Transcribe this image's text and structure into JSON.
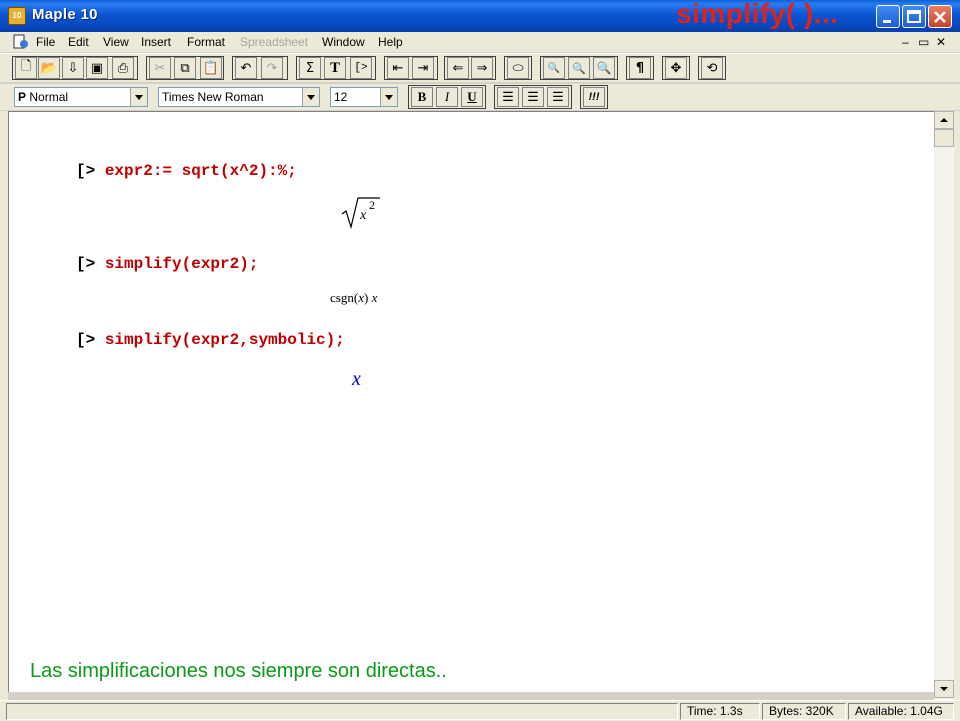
{
  "window": {
    "title": "Maple 10",
    "overlay_title": "simplify( )...",
    "app_icon_text": "10",
    "controls": [
      "minimize",
      "maximize",
      "close"
    ]
  },
  "menubar": {
    "items": [
      {
        "label": "File",
        "enabled": true
      },
      {
        "label": "Edit",
        "enabled": true
      },
      {
        "label": "View",
        "enabled": true
      },
      {
        "label": "Insert",
        "enabled": true
      },
      {
        "label": "Format",
        "enabled": true
      },
      {
        "label": "Spreadsheet",
        "enabled": false
      },
      {
        "label": "Window",
        "enabled": true
      },
      {
        "label": "Help",
        "enabled": true
      }
    ]
  },
  "toolbar": {
    "text_T": "T",
    "sigma": "Σ",
    "prompt_btn": "[>",
    "para": "¶",
    "exec": "!!!"
  },
  "format_bar": {
    "style_prefix": "P",
    "style": "Normal",
    "font": "Times New Roman",
    "size": "12",
    "bold": "B",
    "italic": "I",
    "underline": "U"
  },
  "worksheet": {
    "prompt": "[>",
    "commands": [
      {
        "input": "expr2:= sqrt(x^2):%;"
      },
      {
        "input": "simplify(expr2);"
      },
      {
        "input": "simplify(expr2,symbolic);"
      }
    ],
    "outputs": {
      "out1_var": "x",
      "out1_exp": "2",
      "out2_fn": "csgn",
      "out2_lp": "(",
      "out2_arg": "x",
      "out2_rp": ")",
      "out2_tail": "x",
      "out3": "x"
    }
  },
  "caption": "Las simplificaciones nos siempre son directas..",
  "status": {
    "time": "Time:  1.3s",
    "bytes": "Bytes:  320K",
    "available": "Available:  1.04G"
  },
  "colors": {
    "titlebar": "#0b56d2",
    "overlay_title": "#e0221c",
    "command_text": "#c00000",
    "output_symbolic": "#0000c0",
    "caption": "#0a9a16"
  }
}
